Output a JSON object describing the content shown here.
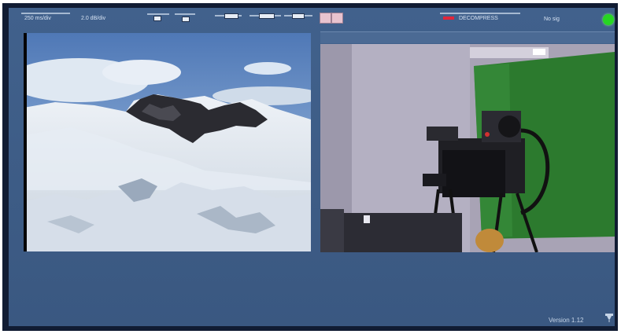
{
  "toolbar": {
    "left_label_1": "250 ms/div",
    "left_label_2": "2.0 dB/div",
    "right_status": "DECOMPRESS",
    "right_label": "No sig",
    "status_led_color": "#27d623"
  },
  "videos": {
    "left": {
      "description_icon": "mountain-glacier-video"
    },
    "right": {
      "description_icon": "studio-camera-green-screen-video"
    }
  },
  "footer": {
    "version": "Version 1.12",
    "settings_icon": "pin-icon"
  }
}
